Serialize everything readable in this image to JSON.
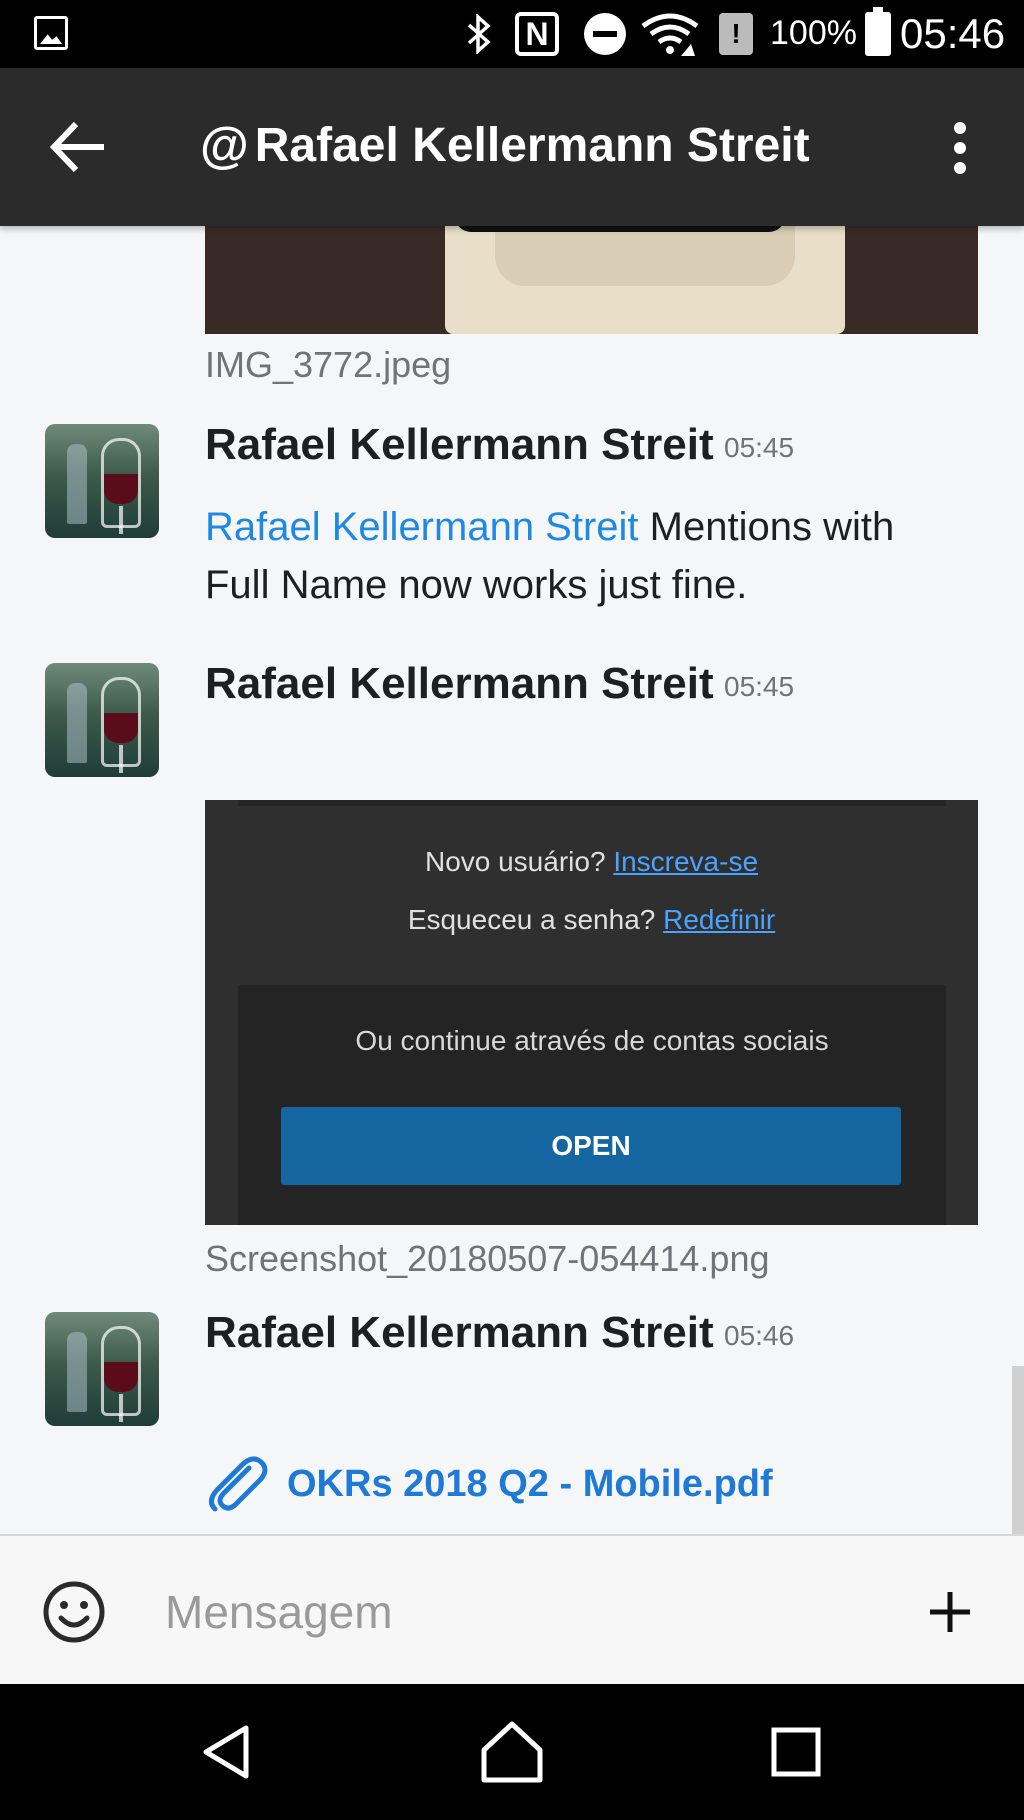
{
  "status_bar": {
    "battery": "100%",
    "time": "05:46",
    "icons": [
      "gallery-icon",
      "bluetooth-icon",
      "nfc-icon",
      "do-not-disturb-icon",
      "wifi-icon",
      "alert-icon",
      "battery-icon"
    ],
    "nfc_letter": "N",
    "alert_glyph": "!"
  },
  "header": {
    "title": "Rafael Kellermann Streit",
    "at_symbol": "@"
  },
  "messages": {
    "top_image_filename": "IMG_3772.jpeg",
    "items": [
      {
        "author": "Rafael Kellermann Streit",
        "time": "05:45",
        "mention": "Rafael Kellermann Streit",
        "text": " Mentions with Full Name now works just fine."
      },
      {
        "author": "Rafael Kellermann Streit",
        "time": "05:45",
        "attachment_filename": "Screenshot_20180507-054414.png"
      },
      {
        "author": "Rafael Kellermann Streit",
        "time": "05:46",
        "file": "OKRs 2018 Q2 - Mobile.pdf"
      }
    ]
  },
  "screenshot": {
    "new_user": "Novo usuário? ",
    "signup_link": "Inscreva-se",
    "forgot": "Esqueceu a senha? ",
    "reset_link": "Redefinir",
    "social": "Ou continue através de contas sociais",
    "open_button": "OPEN"
  },
  "composer": {
    "placeholder": "Mensagem"
  },
  "colors": {
    "app_bar": "#2b2b2b",
    "mention": "#1e88e5",
    "link": "#1e7ad6",
    "open_button": "#1565a0"
  }
}
